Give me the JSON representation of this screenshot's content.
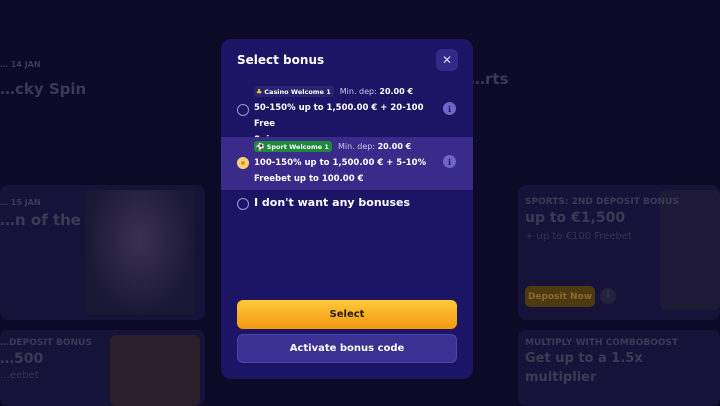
{
  "background": {
    "date1": "… 14 JAN",
    "title1": "…cky Spin",
    "title2": "…rts",
    "date2": "… 15 JAN",
    "title3": "…n of the",
    "right_card": {
      "heading": "SPORTS: 2ND DEPOSIT BONUS",
      "amount": "up to €1,500",
      "sub": "+ up to €100 Freebet",
      "button_label": "Deposit Now",
      "info_glyph": "i"
    },
    "bottom_left": {
      "heading": "…DEPOSIT BONUS",
      "amount": "…500",
      "sub": "…eebet"
    },
    "bottom_right": {
      "heading": "MULTIPLY WITH COMBOBOOST",
      "line1": "Get up to a 1.5x",
      "line2": "multiplier"
    }
  },
  "modal": {
    "title": "Select bonus",
    "close_glyph": "✕",
    "options": [
      {
        "badge": "Casino Welcome 1",
        "badge_icon": "cherry-icon",
        "min_dep_label": "Min. dep:",
        "min_dep_value": "20.00 €",
        "desc_line1": "50-150% up to 1,500.00 € + 20-100 Free",
        "desc_line2": "Spins",
        "selected": false,
        "info_glyph": "i"
      },
      {
        "badge": "Sport Welcome 1",
        "badge_icon": "soccer-ball-icon",
        "min_dep_label": "Min. dep:",
        "min_dep_value": "20.00 €",
        "desc_line1": "100-150% up to 1,500.00 € + 5-10%",
        "desc_line2": "Freebet up to 100.00 €",
        "selected": true,
        "info_glyph": "i"
      }
    ],
    "no_bonus_label": "I don't want any bonuses",
    "select_button": "Select",
    "activate_button": "Activate bonus code"
  },
  "colors": {
    "modal_bg": "#1c1566",
    "selected_row": "#3a2a8a",
    "primary_button": "#f5a623",
    "sport_badge": "#1d8a3a"
  }
}
